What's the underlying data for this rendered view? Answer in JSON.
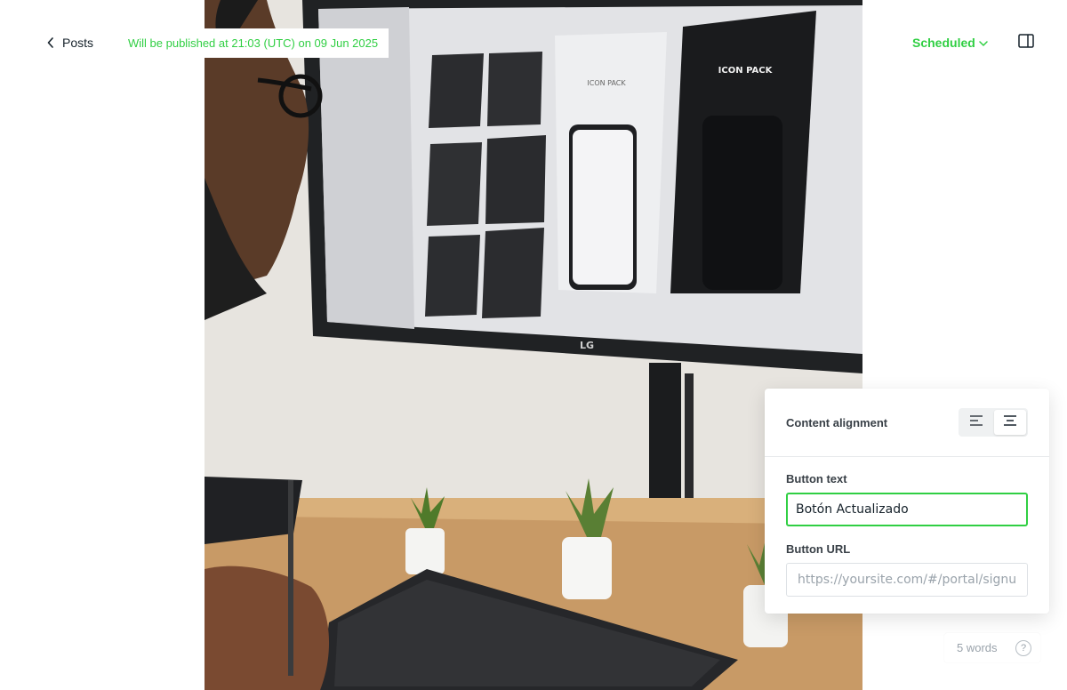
{
  "header": {
    "back_label": "Posts",
    "publish_note": "Will be published at 21:03 (UTC) on 09 Jun 2025",
    "status_label": "Scheduled"
  },
  "photo": {
    "monitor_brand": "LG",
    "screen_text": "ICON PACK"
  },
  "settings": {
    "alignment_label": "Content alignment",
    "alignment_options": [
      "left-align-icon",
      "center-align-icon"
    ],
    "alignment_selected": "center",
    "button_text_label": "Button text",
    "button_text_value": "Botón Actualizado",
    "button_url_label": "Button URL",
    "button_url_placeholder": "https://yoursite.com/#/portal/signup/"
  },
  "footer": {
    "word_count": "5 words",
    "help_glyph": "?"
  },
  "colors": {
    "accent_green": "#30cf43",
    "text_dark": "#15212a"
  }
}
